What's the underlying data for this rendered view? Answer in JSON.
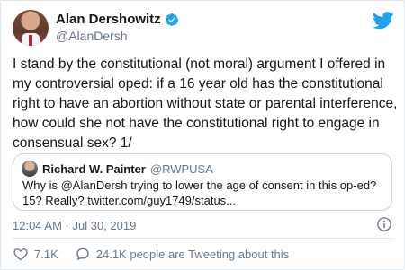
{
  "tweet": {
    "author_name": "Alan Dershowitz",
    "author_handle": "@AlanDersh",
    "text": "I stand by the constitutional (not moral) argument I offered in my controversial oped: if a 16 year old has the constitutional right to have an abortion without state or parental interference, how could she not have the constitutional right to engage in consensual sex? 1/",
    "timestamp": "12:04 AM · Jul 30, 2019",
    "likes": "7.1K",
    "tweeting_about": "24.1K people are Tweeting about this"
  },
  "quote": {
    "author_name": "Richard W. Painter",
    "author_handle": "@RWPUSA",
    "text": "Why is @AlanDersh trying to lower the age of consent in this op-ed? 15? Really? twitter.com/guy1749/status..."
  },
  "colors": {
    "twitter_blue": "#1da1f2",
    "secondary_text": "#657786",
    "border": "#e1e8ed"
  },
  "icons": [
    "verified-icon",
    "twitter-bird-icon",
    "info-icon",
    "heart-icon",
    "reply-bubble-icon"
  ]
}
